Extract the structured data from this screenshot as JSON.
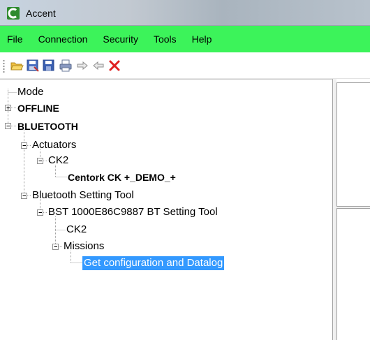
{
  "window": {
    "title": "Accent"
  },
  "menu": {
    "items": [
      {
        "label": "File"
      },
      {
        "label": "Connection"
      },
      {
        "label": "Security"
      },
      {
        "label": "Tools"
      },
      {
        "label": "Help"
      }
    ]
  },
  "toolbar": {
    "buttons": [
      {
        "icon": "open-folder-icon"
      },
      {
        "icon": "save-as-icon"
      },
      {
        "icon": "save-icon"
      },
      {
        "icon": "print-icon"
      },
      {
        "icon": "forward-arrow-icon"
      },
      {
        "icon": "back-arrow-icon"
      },
      {
        "icon": "delete-icon"
      }
    ]
  },
  "tree": {
    "mode": "Mode",
    "offline": "OFFLINE",
    "bluetooth": "BLUETOOTH",
    "actuators": "Actuators",
    "ck2_actuator": "CK2",
    "centork": "Centork CK +_DEMO_+",
    "bt_setting_tool": "Bluetooth Setting Tool",
    "bst_device": "BST 1000E86C9887 BT Setting Tool",
    "ck2_bst": "CK2",
    "missions": "Missions",
    "get_config": "Get configuration and Datalog"
  },
  "colors": {
    "menubar": "#3cf35a",
    "selection": "#3399ff",
    "delete_red": "#e02020"
  }
}
